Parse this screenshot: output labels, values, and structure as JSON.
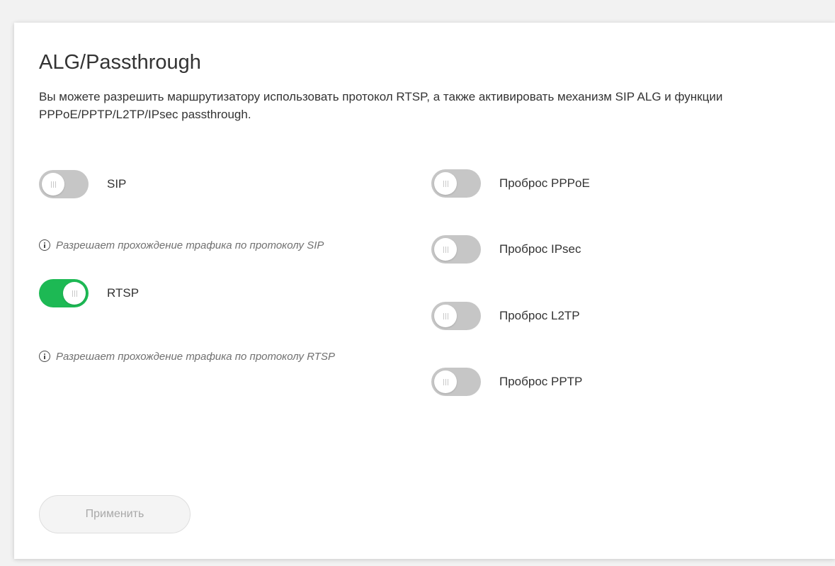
{
  "page": {
    "title": "ALG/Passthrough",
    "description": "Вы можете разрешить маршрутизатору использовать протокол RTSP, а также активировать механизм SIP ALG и функции PPPoE/PPTP/L2TP/IPsec passthrough."
  },
  "left_column": [
    {
      "label": "SIP",
      "enabled": false,
      "hint": "Разрешает прохождение трафика по протоколу SIP"
    },
    {
      "label": "RTSP",
      "enabled": true,
      "hint": "Разрешает прохождение трафика по протоколу RTSP"
    }
  ],
  "right_column": [
    {
      "label": "Проброс PPPoE",
      "enabled": false
    },
    {
      "label": "Проброс IPsec",
      "enabled": false
    },
    {
      "label": "Проброс L2TP",
      "enabled": false
    },
    {
      "label": "Проброс PPTP",
      "enabled": false
    }
  ],
  "actions": {
    "apply_label": "Применить",
    "apply_enabled": false
  },
  "colors": {
    "toggle_on": "#1db954",
    "toggle_off": "#c6c6c6",
    "info_icon": "#4a4a4a"
  },
  "icons": {
    "hint_icon": "info-icon",
    "toggle_knob": "grip-icon"
  }
}
